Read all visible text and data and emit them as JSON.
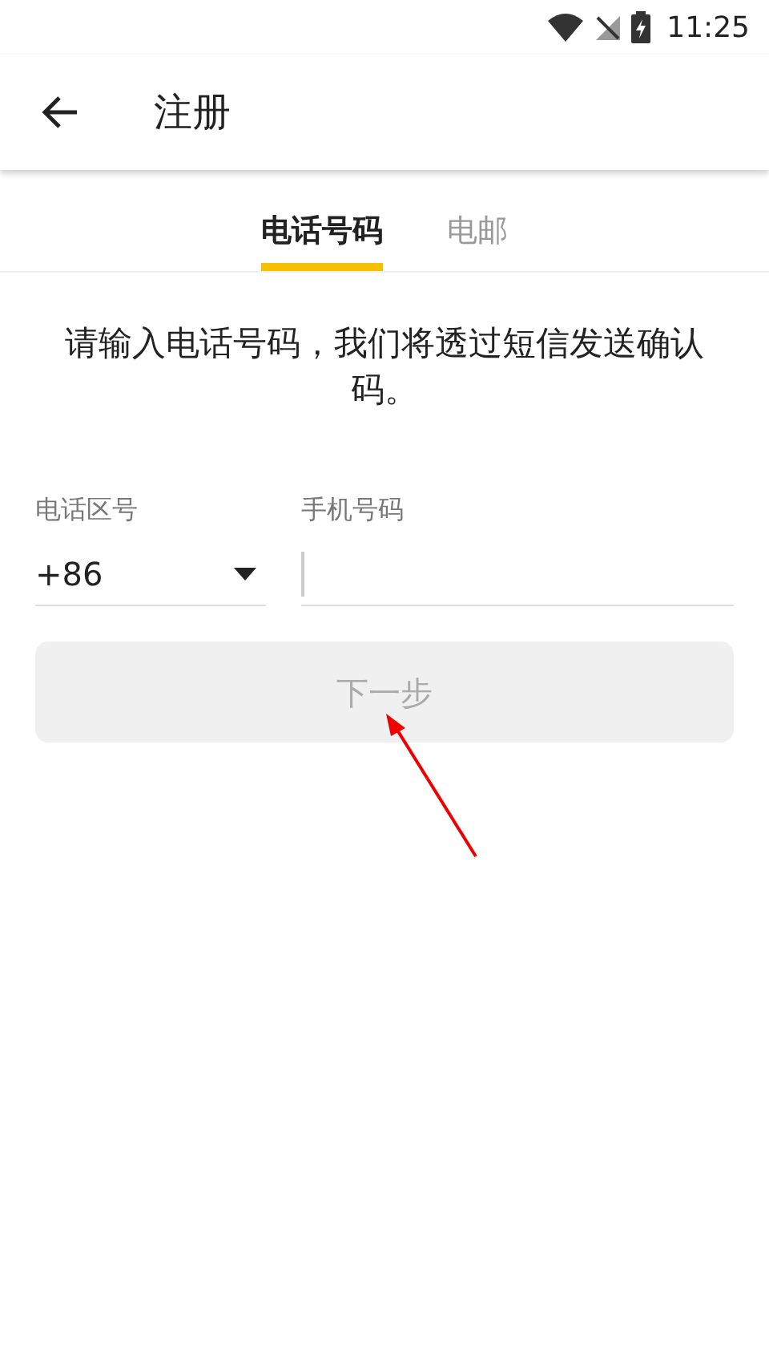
{
  "status_bar": {
    "time": "11:25"
  },
  "app_bar": {
    "title": "注册"
  },
  "tabs": [
    {
      "label": "电话号码",
      "selected": true
    },
    {
      "label": "电邮",
      "selected": false
    }
  ],
  "instruction": "请输入电话号码，我们将透过短信发送确认码。",
  "form": {
    "country_code": {
      "label": "电话区号",
      "value": "+86"
    },
    "phone": {
      "label": "手机号码"
    }
  },
  "next_button": {
    "label": "下一步",
    "disabled": true
  }
}
